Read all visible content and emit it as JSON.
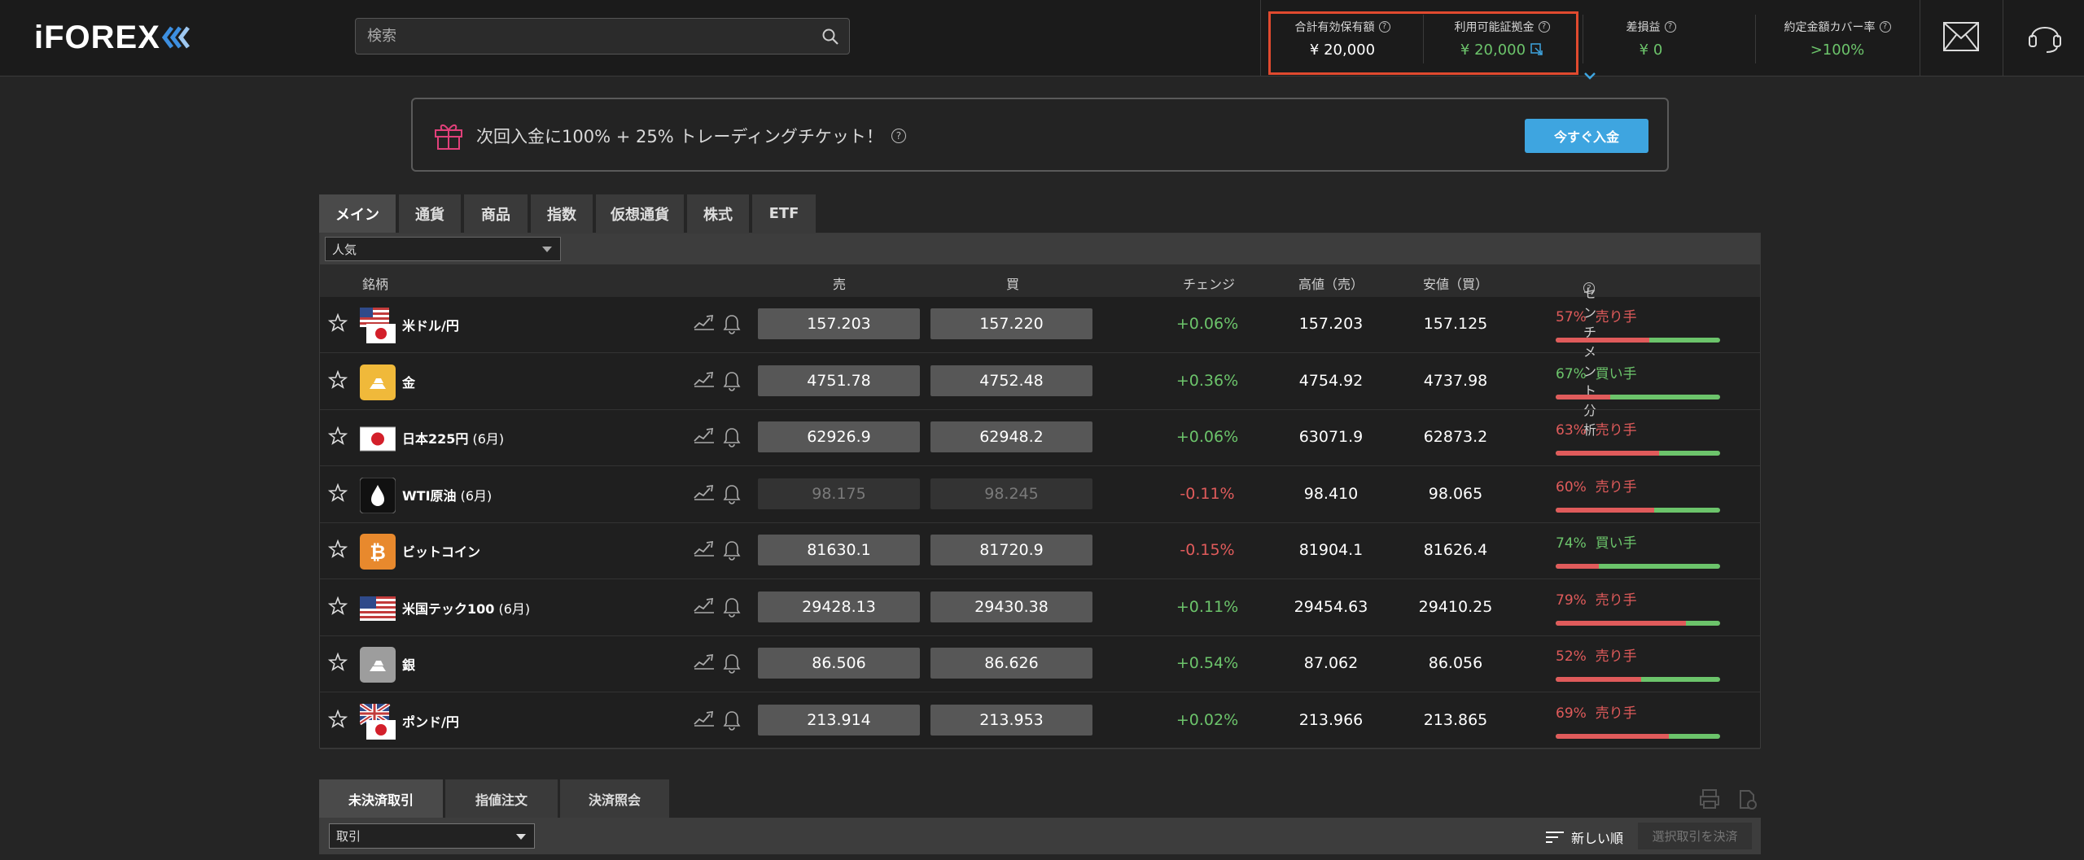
{
  "header": {
    "logo": "iFOREX",
    "search_placeholder": "検索",
    "stats": [
      {
        "label": "合計有効保有額",
        "value": "¥ 20,000",
        "color": "#ffffff"
      },
      {
        "label": "利用可能証拠金",
        "value": "¥ 20,000",
        "color": "#6cc46b"
      },
      {
        "label": "差損益",
        "value": "¥ 0",
        "color": "#6cc46b"
      },
      {
        "label": "約定金額カバー率",
        "value": ">100%",
        "color": "#6cc46b"
      }
    ]
  },
  "promo": {
    "text": "次回入金に100% + 25% トレーディングチケット！",
    "button": "今すぐ入金"
  },
  "tabs": [
    "メイン",
    "通貨",
    "商品",
    "指数",
    "仮想通貨",
    "株式",
    "ETF"
  ],
  "filter": {
    "selected": "人気"
  },
  "columns": {
    "symbol": "銘柄",
    "sell": "売",
    "buy": "買",
    "change": "チェンジ",
    "high": "高値（売）",
    "low": "安値（買）",
    "sentiment": "センチメント分析"
  },
  "rows": [
    {
      "name": "米ドル/円",
      "sub": "",
      "sell": "157.203",
      "buy": "157.220",
      "change": "+0.06%",
      "dir": "pos",
      "high": "157.203",
      "low": "157.125",
      "sent_pct": "57%",
      "sent_label": "売り手",
      "sent_side": "sell",
      "sell_share": 0.57,
      "icon": "usd-jpy-flag",
      "dim": false
    },
    {
      "name": "金",
      "sub": "",
      "sell": "4751.78",
      "buy": "4752.48",
      "change": "+0.36%",
      "dir": "pos",
      "high": "4754.92",
      "low": "4737.98",
      "sent_pct": "67%",
      "sent_label": "買い手",
      "sent_side": "buy",
      "sell_share": 0.33,
      "icon": "gold-icon",
      "dim": false
    },
    {
      "name": "日本225円",
      "sub": " (6月)",
      "sell": "62926.9",
      "buy": "62948.2",
      "change": "+0.06%",
      "dir": "pos",
      "high": "63071.9",
      "low": "62873.2",
      "sent_pct": "63%",
      "sent_label": "売り手",
      "sent_side": "sell",
      "sell_share": 0.63,
      "icon": "japan-flag",
      "dim": false
    },
    {
      "name": "WTI原油",
      "sub": " (6月)",
      "sell": "98.175",
      "buy": "98.245",
      "change": "-0.11%",
      "dir": "neg",
      "high": "98.410",
      "low": "98.065",
      "sent_pct": "60%",
      "sent_label": "売り手",
      "sent_side": "sell",
      "sell_share": 0.6,
      "icon": "oil-icon",
      "dim": true
    },
    {
      "name": "ビットコイン",
      "sub": "",
      "sell": "81630.1",
      "buy": "81720.9",
      "change": "-0.15%",
      "dir": "neg",
      "high": "81904.1",
      "low": "81626.4",
      "sent_pct": "74%",
      "sent_label": "買い手",
      "sent_side": "buy",
      "sell_share": 0.26,
      "icon": "bitcoin-icon",
      "dim": false
    },
    {
      "name": "米国テック100",
      "sub": " (6月)",
      "sell": "29428.13",
      "buy": "29430.38",
      "change": "+0.11%",
      "dir": "pos",
      "high": "29454.63",
      "low": "29410.25",
      "sent_pct": "79%",
      "sent_label": "売り手",
      "sent_side": "sell",
      "sell_share": 0.79,
      "icon": "us-flag",
      "dim": false
    },
    {
      "name": "銀",
      "sub": "",
      "sell": "86.506",
      "buy": "86.626",
      "change": "+0.54%",
      "dir": "pos",
      "high": "87.062",
      "low": "86.056",
      "sent_pct": "52%",
      "sent_label": "売り手",
      "sent_side": "sell",
      "sell_share": 0.52,
      "icon": "silver-icon",
      "dim": false
    },
    {
      "name": "ポンド/円",
      "sub": "",
      "sell": "213.914",
      "buy": "213.953",
      "change": "+0.02%",
      "dir": "pos",
      "high": "213.966",
      "low": "213.865",
      "sent_pct": "69%",
      "sent_label": "売り手",
      "sent_side": "sell",
      "sell_share": 0.69,
      "icon": "gbp-jpy-flag",
      "dim": false
    }
  ],
  "bottom": {
    "tabs": [
      "未決済取引",
      "指値注文",
      "決済照会"
    ],
    "select": "取引",
    "sort": "新しい順",
    "close_button": "選択取引を決済"
  }
}
